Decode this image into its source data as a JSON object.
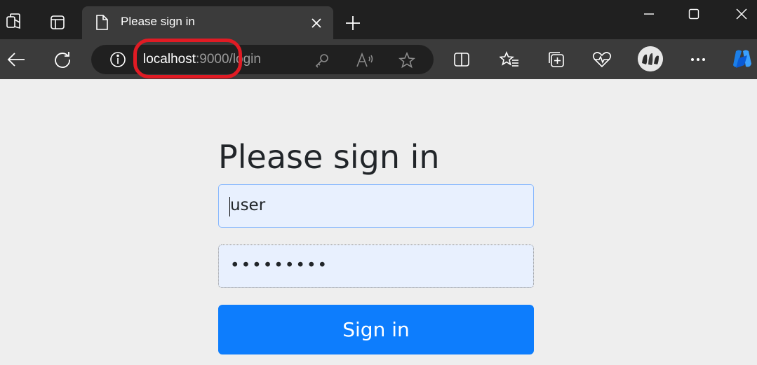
{
  "browser": {
    "tab": {
      "title": "Please sign in"
    },
    "address": {
      "host": "localhost",
      "port": ":9000",
      "path": "/login"
    }
  },
  "page": {
    "heading": "Please sign in",
    "username": {
      "value": "user"
    },
    "password": {
      "value": "•••••••••"
    },
    "submit_label": "Sign in"
  },
  "colors": {
    "highlight": "#e01b24",
    "primary": "#0d7dfd",
    "field_bg": "#e8f0fe"
  }
}
